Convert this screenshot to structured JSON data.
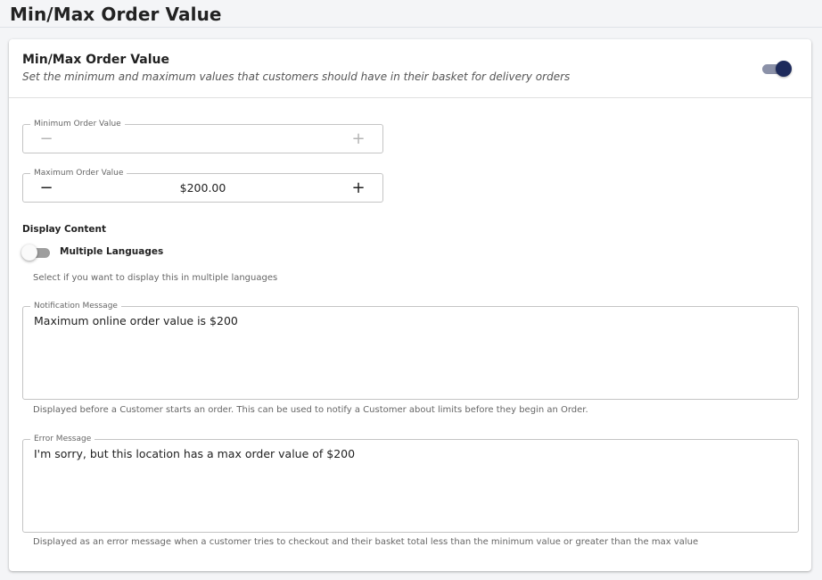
{
  "page": {
    "title": "Min/Max Order Value"
  },
  "card": {
    "title": "Min/Max Order Value",
    "subtitle": "Set the minimum and maximum values that customers should have in their basket for delivery orders",
    "enabled": true
  },
  "min_order": {
    "label": "Minimum Order Value",
    "value": "",
    "minus": "−",
    "plus": "+"
  },
  "max_order": {
    "label": "Maximum Order Value",
    "value": "$200.00",
    "minus": "−",
    "plus": "+"
  },
  "display_content": {
    "heading": "Display Content",
    "multiple_languages": {
      "label": "Multiple Languages",
      "enabled": false,
      "helper": "Select if you want to display this in multiple languages"
    }
  },
  "notification_message": {
    "label": "Notification Message",
    "value": "Maximum online order value is $200",
    "helper": "Displayed before a Customer starts an order. This can be used to notify a Customer about limits before they begin an Order."
  },
  "error_message": {
    "label": "Error Message",
    "value": "I'm sorry, but this location has a max order value of $200",
    "helper": "Displayed as an error message when a customer tries to checkout and their basket total less than the minimum value or greater than the max value"
  },
  "colors": {
    "toggle_on_thumb": "#1d2a5b",
    "toggle_on_track": "#8b91a8",
    "toggle_off_track": "#9e9e9e"
  }
}
